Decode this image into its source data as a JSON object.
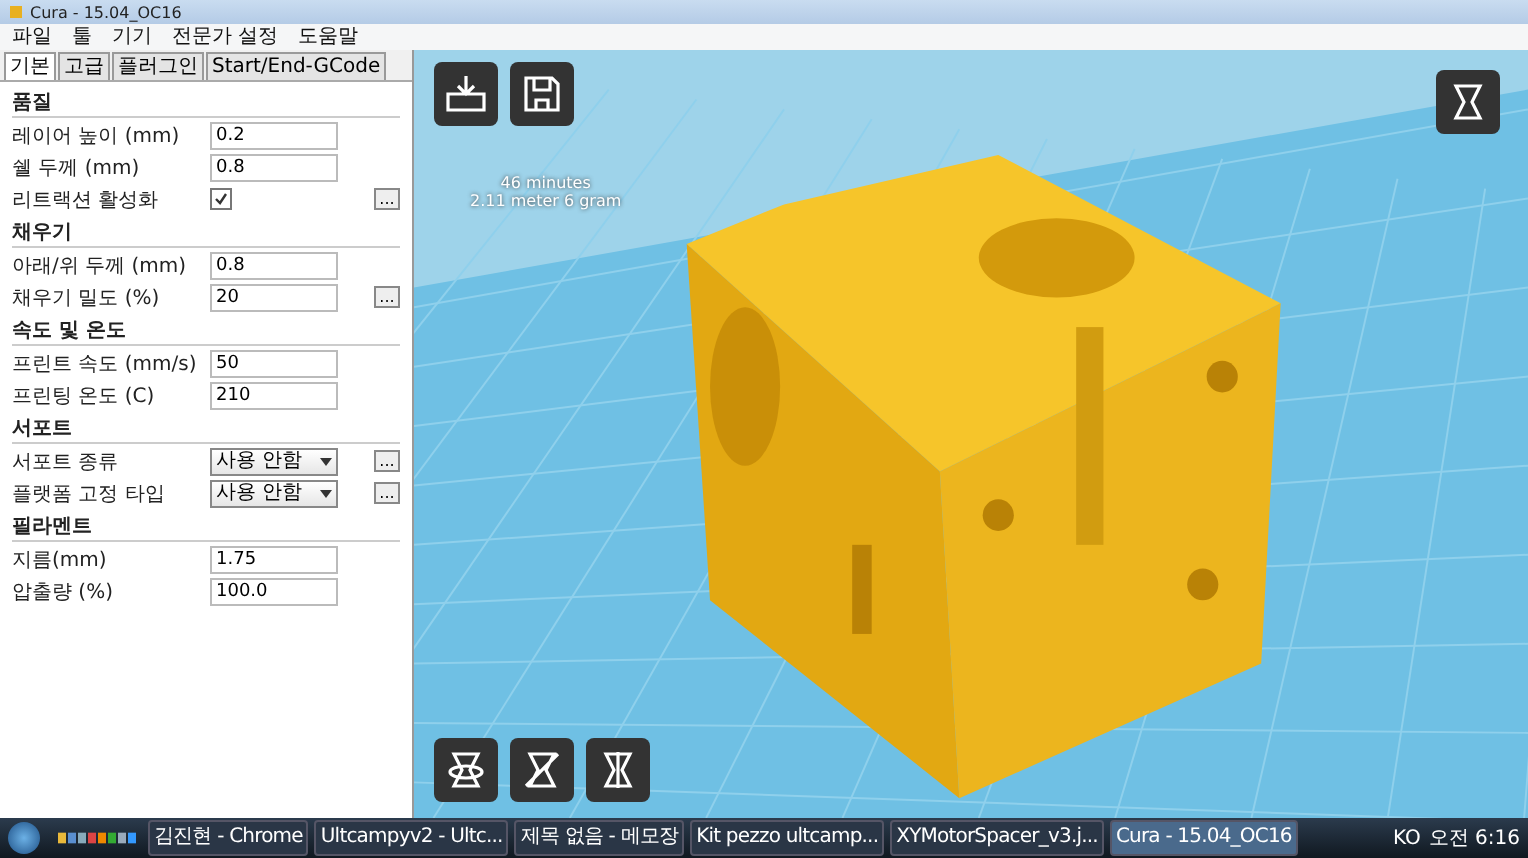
{
  "window": {
    "title": "Cura - 15.04_OC16"
  },
  "menu": [
    "파일",
    "툴",
    "기기",
    "전문가 설정",
    "도움말"
  ],
  "tabs": [
    {
      "label": "기본",
      "selected": true
    },
    {
      "label": "고급",
      "selected": false
    },
    {
      "label": "플러그인",
      "selected": false
    },
    {
      "label": "Start/End-GCode",
      "selected": false
    }
  ],
  "sections": [
    {
      "title": "품질",
      "fields": [
        {
          "kind": "text",
          "label": "레이어 높이 (mm)",
          "value": "0.2"
        },
        {
          "kind": "text",
          "label": "쉘 두께 (mm)",
          "value": "0.8"
        },
        {
          "kind": "checkbox",
          "label": "리트랙션 활성화",
          "checked": true,
          "more_button": "..."
        }
      ]
    },
    {
      "title": "채우기",
      "fields": [
        {
          "kind": "text",
          "label": "아래/위 두께 (mm)",
          "value": "0.8"
        },
        {
          "kind": "text",
          "label": "채우기 밀도 (%)",
          "value": "20",
          "more_button": "..."
        }
      ]
    },
    {
      "title": "속도 및 온도",
      "fields": [
        {
          "kind": "text",
          "label": "프린트 속도 (mm/s)",
          "value": "50"
        },
        {
          "kind": "text",
          "label": "프린팅 온도 (C)",
          "value": "210"
        }
      ]
    },
    {
      "title": "서포트",
      "fields": [
        {
          "kind": "select",
          "label": "서포트 종류",
          "value": "사용 안함",
          "more_button": "..."
        },
        {
          "kind": "select",
          "label": "플랫폼 고정 타입",
          "value": "사용 안함",
          "more_button": "..."
        }
      ]
    },
    {
      "title": "필라멘트",
      "fields": [
        {
          "kind": "text",
          "label": "지름(mm)",
          "value": "1.75"
        },
        {
          "kind": "text",
          "label": "압출량 (%)",
          "value": "100.0"
        }
      ]
    }
  ],
  "viewport": {
    "print_info": [
      "46 minutes",
      "2.11 meter 6 gram"
    ]
  },
  "taskbar": {
    "items": [
      {
        "label": "김진현 - Chrome",
        "selected": false
      },
      {
        "label": "Ultcampyv2 - Ultc...",
        "selected": false
      },
      {
        "label": "제목 없음 - 메모장",
        "selected": false
      },
      {
        "label": "Kit pezzo ultcamp...",
        "selected": false
      },
      {
        "label": "XYMotorSpacer_v3.j...",
        "selected": false
      },
      {
        "label": "Cura - 15.04_OC16",
        "selected": true
      }
    ],
    "language": "KO",
    "clock": "오전 6:16"
  }
}
